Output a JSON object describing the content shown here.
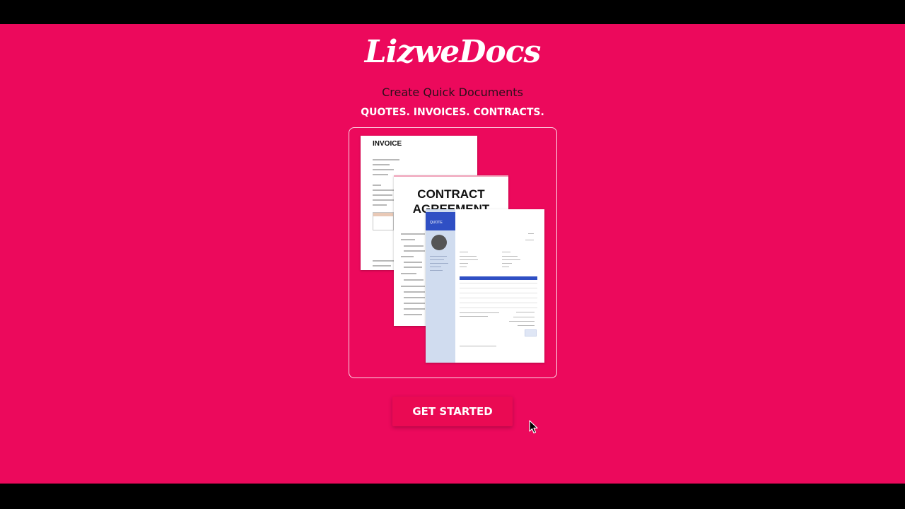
{
  "app": {
    "logo": "LizweDocs",
    "tagline": "Create Quick Documents",
    "subtagline": "QUOTES. INVOICES. CONTRACTS."
  },
  "showcase": {
    "invoice_title": "INVOICE",
    "contract_title": "CONTRACT AGREEMENT",
    "quote_label": "QUOTE"
  },
  "cta": {
    "label": "GET STARTED"
  },
  "colors": {
    "background": "#ec095c",
    "button": "#ea0a53",
    "quote_accent": "#2f4fc4"
  },
  "icons": {
    "cursor": "mouse-pointer-icon"
  }
}
